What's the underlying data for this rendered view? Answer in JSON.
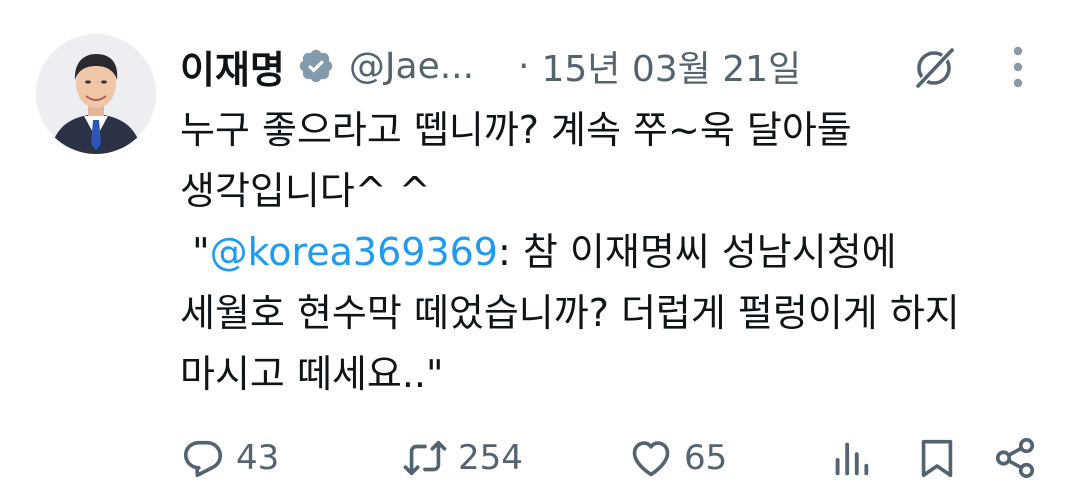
{
  "tweet": {
    "display_name": "이재명",
    "handle": "@Jae...",
    "separator": "·",
    "date": "15년 03월 21일",
    "text_line1": "누구 좋으라고 뗍니까? 계속 쭈~욱 달아둘",
    "text_line2": "생각입니다^ ^",
    "quote_prefix": " \"",
    "mention": "@korea369369",
    "quote_rest": ": 참 이재명씨 성남시청에",
    "text_line4": "세월호 현수막 떼었습니까? 더럽게 펄렁이게 하지",
    "text_line5": "마시고 떼세요..\""
  },
  "actions": {
    "replies": "43",
    "retweets": "254",
    "likes": "65"
  },
  "icons": {
    "verified": "verified-badge-icon",
    "grok": "grok-icon",
    "more": "more-options-icon",
    "reply": "reply-icon",
    "retweet": "retweet-icon",
    "like": "heart-icon",
    "views": "analytics-icon",
    "bookmark": "bookmark-icon",
    "share": "share-icon"
  },
  "colors": {
    "link": "#1d9bf0",
    "secondary_text": "#536471",
    "primary_text": "#0f1419"
  }
}
